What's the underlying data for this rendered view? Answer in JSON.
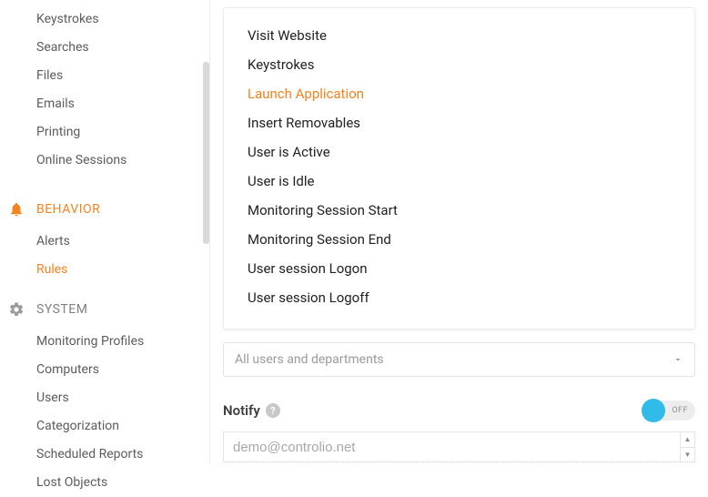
{
  "sidebar": {
    "top_items": [
      {
        "label": "Keystrokes"
      },
      {
        "label": "Searches"
      },
      {
        "label": "Files"
      },
      {
        "label": "Emails"
      },
      {
        "label": "Printing"
      },
      {
        "label": "Online Sessions"
      }
    ],
    "behavior": {
      "label": "BEHAVIOR",
      "items": [
        {
          "label": "Alerts"
        },
        {
          "label": "Rules",
          "active": true
        }
      ]
    },
    "system": {
      "label": "SYSTEM",
      "items": [
        {
          "label": "Monitoring Profiles"
        },
        {
          "label": "Computers"
        },
        {
          "label": "Users"
        },
        {
          "label": "Categorization"
        },
        {
          "label": "Scheduled Reports"
        },
        {
          "label": "Lost Objects"
        }
      ]
    }
  },
  "event_options": [
    {
      "label": "Visit Website"
    },
    {
      "label": "Keystrokes"
    },
    {
      "label": "Launch Application",
      "selected": true
    },
    {
      "label": "Insert Removables"
    },
    {
      "label": "User is Active"
    },
    {
      "label": "User is Idle"
    },
    {
      "label": "Monitoring Session Start"
    },
    {
      "label": "Monitoring Session End"
    },
    {
      "label": "User session Logon"
    },
    {
      "label": "User session Logoff"
    }
  ],
  "users_select": {
    "placeholder": "All users and departments"
  },
  "notify": {
    "label": "Notify",
    "toggle_state": "OFF",
    "email_placeholder": "demo@controlio.net"
  }
}
